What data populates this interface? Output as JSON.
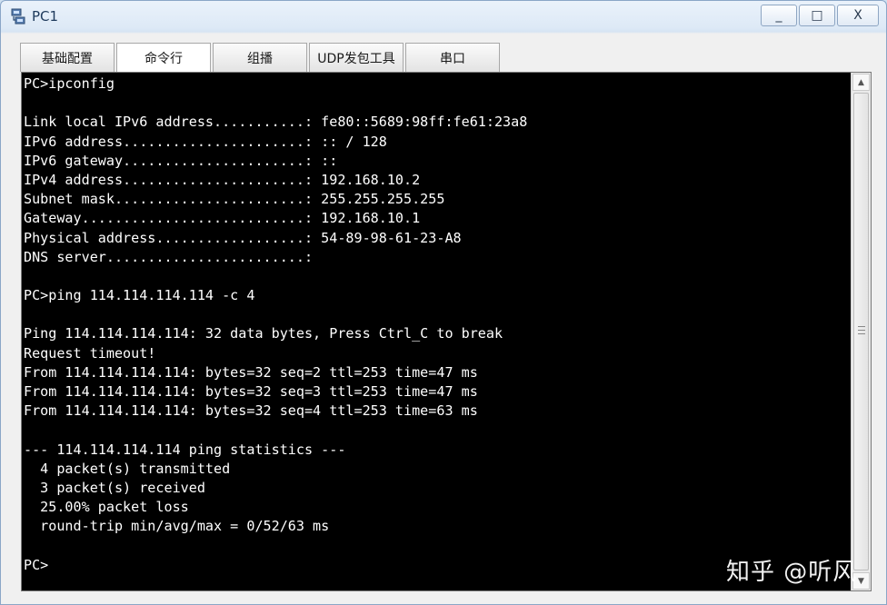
{
  "window": {
    "title": "PC1",
    "minimize_label": "_",
    "maximize_label": "□",
    "close_label": "X"
  },
  "tabs": [
    {
      "label": "基础配置"
    },
    {
      "label": "命令行"
    },
    {
      "label": "组播"
    },
    {
      "label": "UDP发包工具"
    },
    {
      "label": "串口"
    }
  ],
  "active_tab": "命令行",
  "console": {
    "lines": [
      "PC>ipconfig",
      "",
      "Link local IPv6 address...........: fe80::5689:98ff:fe61:23a8",
      "IPv6 address......................: :: / 128",
      "IPv6 gateway......................: ::",
      "IPv4 address......................: 192.168.10.2",
      "Subnet mask.......................: 255.255.255.255",
      "Gateway...........................: 192.168.10.1",
      "Physical address..................: 54-89-98-61-23-A8",
      "DNS server........................:",
      "",
      "PC>ping 114.114.114.114 -c 4",
      "",
      "Ping 114.114.114.114: 32 data bytes, Press Ctrl_C to break",
      "Request timeout!",
      "From 114.114.114.114: bytes=32 seq=2 ttl=253 time=47 ms",
      "From 114.114.114.114: bytes=32 seq=3 ttl=253 time=47 ms",
      "From 114.114.114.114: bytes=32 seq=4 ttl=253 time=63 ms",
      "",
      "--- 114.114.114.114 ping statistics ---",
      "  4 packet(s) transmitted",
      "  3 packet(s) received",
      "  25.00% packet loss",
      "  round-trip min/avg/max = 0/52/63 ms",
      "",
      "PC>"
    ]
  },
  "scrollbar": {
    "up_arrow": "▲",
    "down_arrow": "▼"
  },
  "watermark": {
    "text": "知乎 @听风"
  },
  "colors": {
    "console_bg": "#000000",
    "console_fg": "#ffffff",
    "title_text": "#1e3a5c"
  }
}
